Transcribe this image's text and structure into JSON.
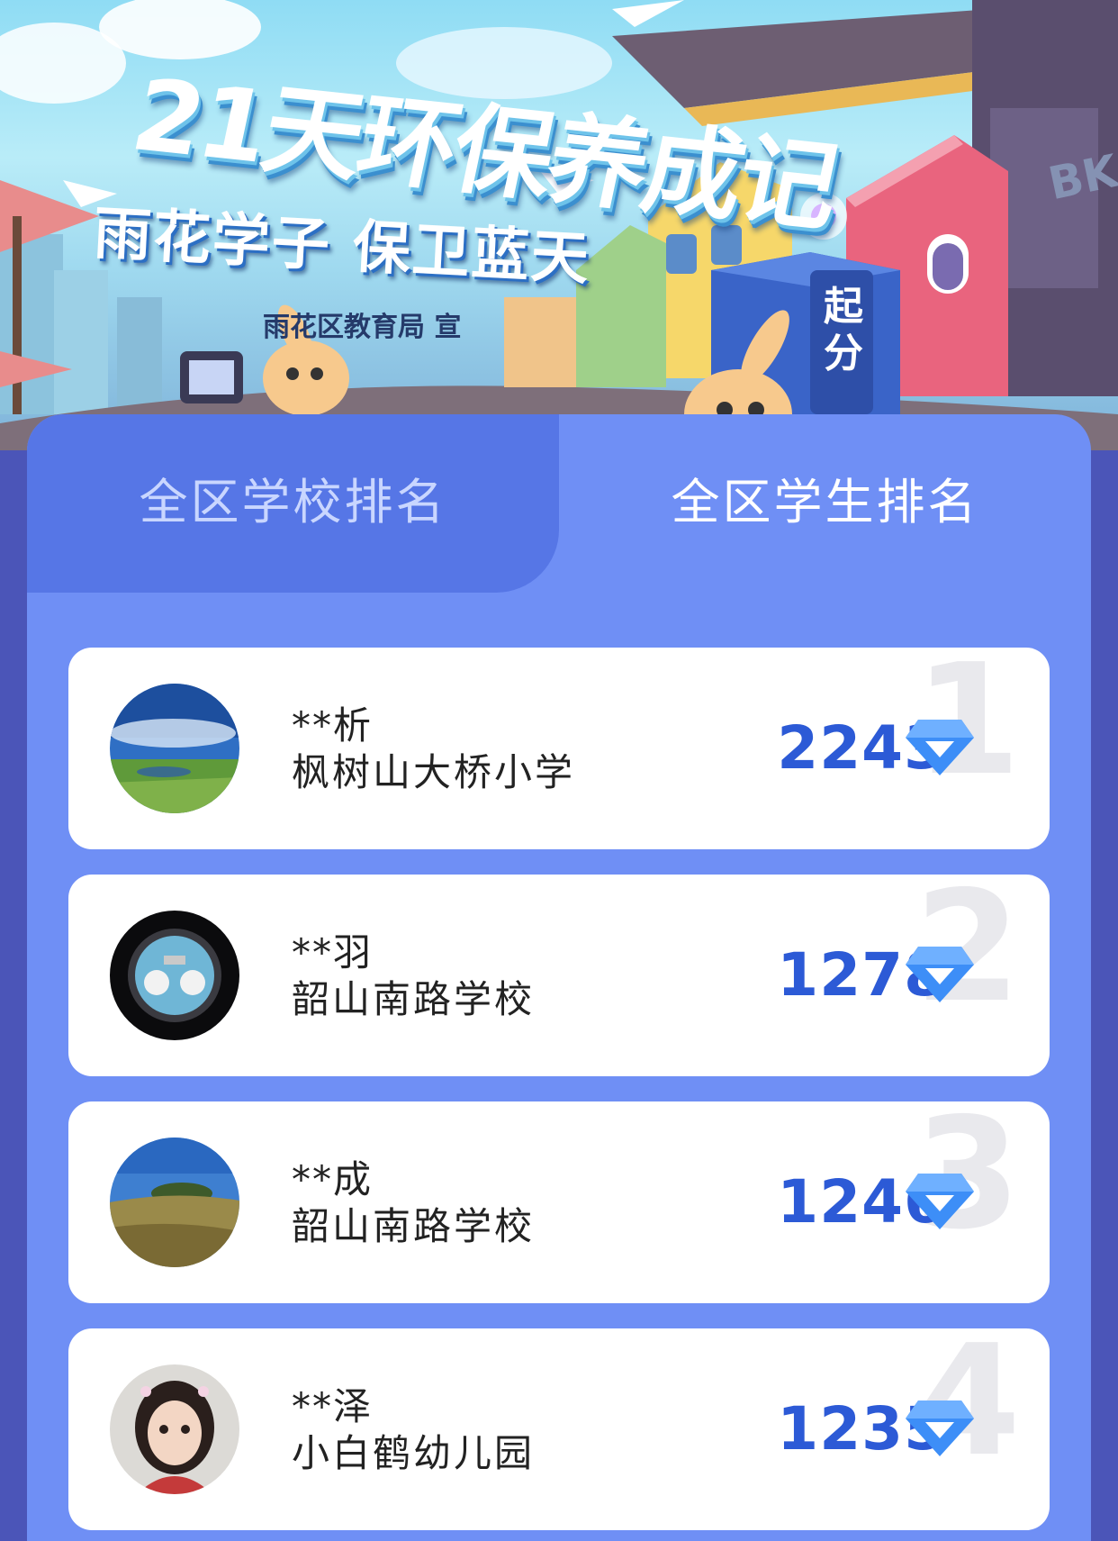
{
  "banner": {
    "title": "21天环保养成记",
    "subtitle": "雨花学子 保卫蓝天",
    "sponsor": "雨花区教育局 宣",
    "sign": [
      "起",
      "分"
    ],
    "graffiti": "BK"
  },
  "tabs": [
    {
      "label": "全区学校排名",
      "active": false
    },
    {
      "label": "全区学生排名",
      "active": true
    }
  ],
  "ranking": [
    {
      "rank": "1",
      "name": "**析",
      "school": "枫树山大桥小学",
      "score": "2243",
      "avatar": "landscape-photo-avatar"
    },
    {
      "rank": "2",
      "name": "**羽",
      "school": "韶山南路学校",
      "score": "1278",
      "avatar": "watch-photo-avatar"
    },
    {
      "rank": "3",
      "name": "**成",
      "school": "韶山南路学校",
      "score": "1246",
      "avatar": "hill-photo-avatar"
    },
    {
      "rank": "4",
      "name": "**泽",
      "school": "小白鹤幼儿园",
      "score": "1235",
      "avatar": "child-photo-avatar"
    }
  ],
  "colors": {
    "panel": "#6f8ff5",
    "inactive_tab": "#5676e6",
    "score": "#2c5ad6",
    "gem": "#3d8ef7",
    "page_background": "#4b55b8"
  },
  "icons": {
    "score_icon": "diamond-icon"
  }
}
